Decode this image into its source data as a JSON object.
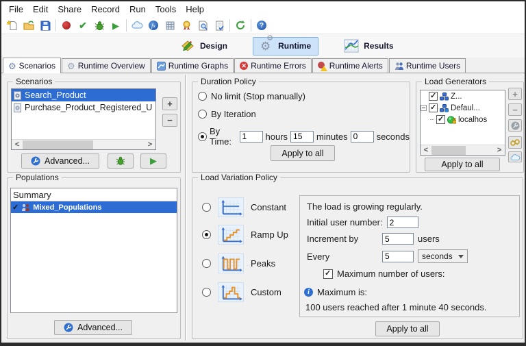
{
  "menu": {
    "items": [
      "File",
      "Edit",
      "Share",
      "Record",
      "Run",
      "Tools",
      "Help"
    ]
  },
  "toolbar": {
    "icons": [
      "new-document",
      "open-project",
      "save",
      "record",
      "validate",
      "debug",
      "play",
      "cloud",
      "functions",
      "data-table",
      "certificate",
      "search-document",
      "check-list",
      "refresh-project",
      "help"
    ]
  },
  "modebar": {
    "items": [
      {
        "label": "Design",
        "selected": false
      },
      {
        "label": "Runtime",
        "selected": true
      },
      {
        "label": "Results",
        "selected": false
      }
    ]
  },
  "tabs": {
    "items": [
      {
        "label": "Scenarios",
        "active": true
      },
      {
        "label": "Runtime Overview",
        "active": false
      },
      {
        "label": "Runtime Graphs",
        "active": false
      },
      {
        "label": "Runtime Errors",
        "active": false
      },
      {
        "label": "Runtime Alerts",
        "active": false
      },
      {
        "label": "Runtime Users",
        "active": false
      }
    ]
  },
  "scenarios": {
    "title": "Scenarios",
    "items": [
      {
        "label": "Search_Product",
        "selected": true
      },
      {
        "label": "Purchase_Product_Registered_U",
        "selected": false
      }
    ],
    "add_label": "+",
    "remove_label": "−",
    "advanced_label": "Advanced..."
  },
  "populations": {
    "title": "Populations",
    "header": "Summary",
    "rows": [
      {
        "label": "Mixed_Populations",
        "checked": true,
        "selected": true
      }
    ],
    "advanced_label": "Advanced..."
  },
  "duration_policy": {
    "title": "Duration Policy",
    "no_limit_label": "No limit (Stop manually)",
    "by_iteration_label": "By Iteration",
    "by_time_label": "By Time:",
    "selected": "By Time",
    "hours_value": "1",
    "hours_label": "hours",
    "minutes_value": "15",
    "minutes_label": "minutes",
    "seconds_value": "0",
    "seconds_label": "seconds",
    "apply_label": "Apply to all"
  },
  "load_generators": {
    "title": "Load Generators",
    "tree": [
      {
        "label": "Z...",
        "level": 0,
        "checked": true
      },
      {
        "label": "Defaul...",
        "level": 1,
        "checked": true
      },
      {
        "label": "localhos",
        "level": 2,
        "checked": true
      }
    ],
    "side_buttons": [
      "add",
      "remove",
      "advanced",
      "provision",
      "cloud"
    ],
    "apply_label": "Apply to all"
  },
  "load_variation": {
    "title": "Load Variation Policy",
    "options": [
      {
        "label": "Constant",
        "selected": false
      },
      {
        "label": "Ramp Up",
        "selected": true
      },
      {
        "label": "Peaks",
        "selected": false
      },
      {
        "label": "Custom",
        "selected": false
      }
    ],
    "panel": {
      "description": "The load is growing regularly.",
      "initial_label": "Initial user number:",
      "initial_value": "2",
      "increment_label": "Increment by",
      "increment_value": "5",
      "increment_unit": "users",
      "every_label": "Every",
      "every_value": "5",
      "every_unit": "seconds",
      "max_users_label": "Maximum number of users:",
      "max_users_checked": true,
      "maximum_label": "Maximum is:",
      "maximum_text": "100 users reached after 1 minute 40 seconds."
    },
    "apply_label": "Apply to all"
  },
  "colors": {
    "selection": "#2d6cd2",
    "runtime_highlight": "#cde3f7",
    "runtime_border": "#7fb2e5",
    "accent_orange": "#e8922a",
    "accent_blue": "#4f81c7"
  }
}
